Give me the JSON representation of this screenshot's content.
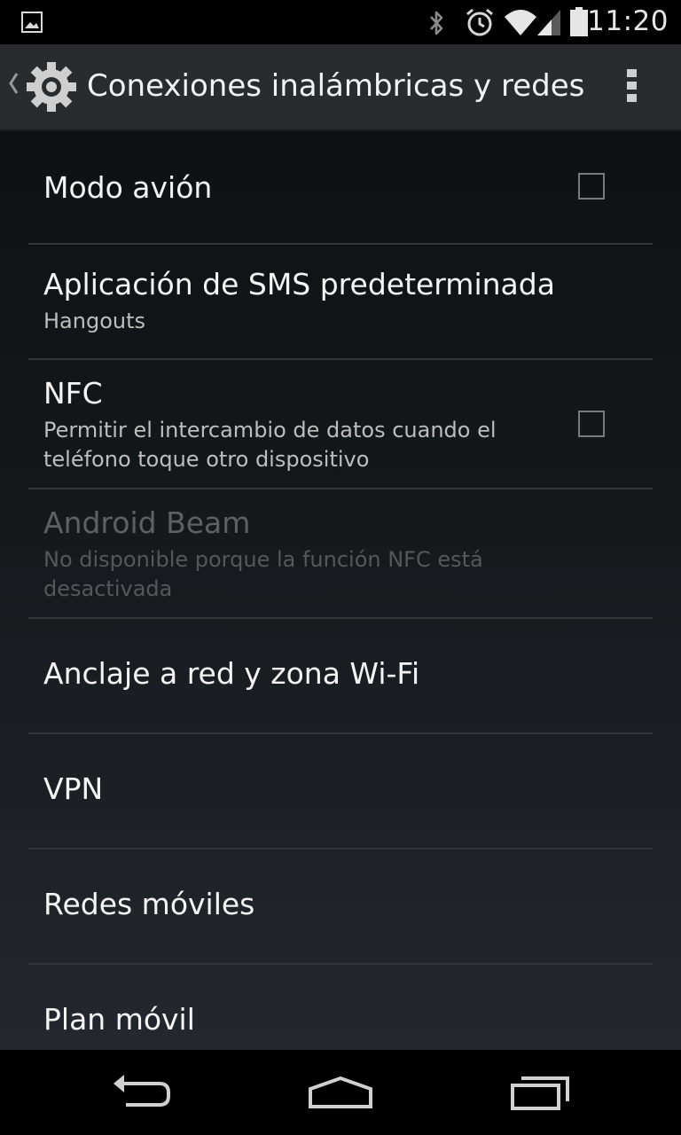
{
  "status_bar": {
    "notification_icon": "image-icon",
    "icons": [
      "bluetooth-icon",
      "alarm-icon",
      "wifi-icon",
      "signal-icon",
      "battery-icon"
    ],
    "time": "11:20"
  },
  "action_bar": {
    "title": "Conexiones inalámbricas y redes",
    "app_icon": "settings-gear-icon",
    "menu_icon": "overflow-menu-icon"
  },
  "settings": {
    "airplane": {
      "title": "Modo avión",
      "checked": false
    },
    "sms": {
      "title": "Aplicación de SMS predeterminada",
      "summary": "Hangouts"
    },
    "nfc": {
      "title": "NFC",
      "summary": "Permitir el intercambio de datos cuando el teléfono toque otro dispositivo",
      "checked": false
    },
    "beam": {
      "title": "Android Beam",
      "summary": "No disponible porque la función NFC está desactivada",
      "enabled": false
    },
    "tethering": {
      "title": "Anclaje a red y zona Wi-Fi"
    },
    "vpn": {
      "title": "VPN"
    },
    "mobile": {
      "title": "Redes móviles"
    },
    "plan": {
      "title": "Plan móvil"
    }
  },
  "nav_bar": {
    "buttons": [
      "back-icon",
      "home-icon",
      "recents-icon"
    ]
  },
  "colors": {
    "action_bar_bg": "#2a2b2c",
    "divider": "#33363b",
    "text_primary": "#f4f4f4",
    "text_secondary": "#bdbdbd",
    "text_disabled": "#5e6064"
  }
}
